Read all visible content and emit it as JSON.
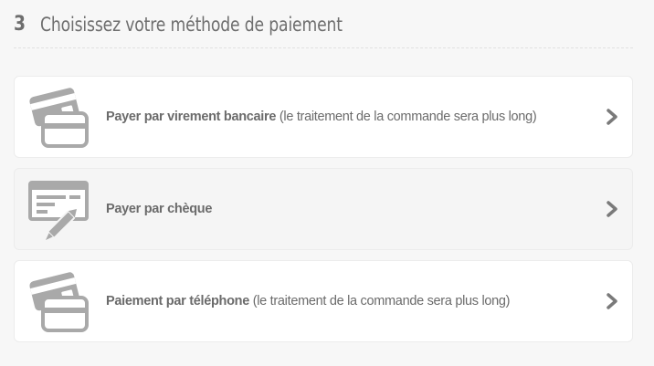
{
  "header": {
    "step_number": "3",
    "title": "Choisissez votre méthode de paiement"
  },
  "options": [
    {
      "label": "Payer par virement bancaire",
      "note": " (le traitement de la commande sera plus long)",
      "icon": "bank-card-icon"
    },
    {
      "label": "Payer par chèque",
      "note": "",
      "icon": "cheque-pen-icon"
    },
    {
      "label": "Paiement par téléphone",
      "note": " (le traitement de la commande sera plus long)",
      "icon": "phone-card-icon"
    }
  ],
  "colors": {
    "icon": "#a9a9a9",
    "text": "#6b6b6b",
    "chevron": "#7a7a7a"
  }
}
